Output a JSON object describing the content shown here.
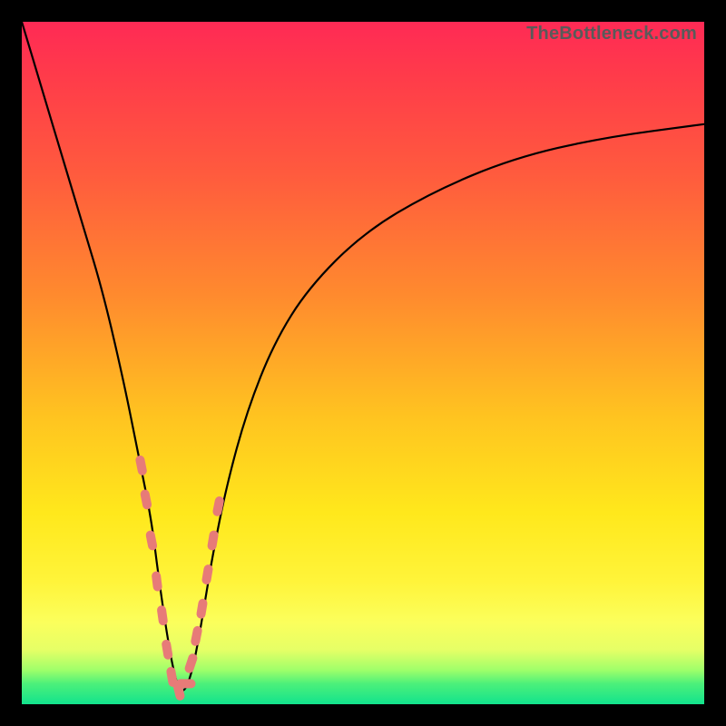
{
  "watermark": "TheBottleneck.com",
  "colors": {
    "background": "#000000",
    "gradient_top": "#ff2a55",
    "gradient_mid1": "#ff8a2e",
    "gradient_mid2": "#ffe81c",
    "gradient_bottom": "#12e38d",
    "curve": "#000000",
    "beads": "#e77b78"
  },
  "chart_data": {
    "type": "line",
    "title": "",
    "xlabel": "",
    "ylabel": "",
    "xlim": [
      0,
      100
    ],
    "ylim": [
      0,
      100
    ],
    "note": "Axes are normalized percentages; y=0 at bottom. Sharp V-shaped bottleneck curve with minimum near x≈23.",
    "series": [
      {
        "name": "bottleneck-curve",
        "x": [
          0,
          3,
          6,
          9,
          12,
          15,
          17,
          19,
          20,
          21,
          22,
          23,
          24,
          25,
          26,
          27,
          28,
          30,
          33,
          37,
          42,
          50,
          60,
          72,
          85,
          100
        ],
        "y": [
          100,
          90,
          80,
          70,
          60,
          47,
          37,
          27,
          19,
          12,
          6,
          2,
          2,
          5,
          10,
          16,
          22,
          32,
          43,
          53,
          61,
          69,
          75,
          80,
          83,
          85
        ]
      }
    ],
    "annotations": {
      "beads_note": "Salmon bead markers clustered along the two curve legs near the trough (approx y 5–25%).",
      "beads_xy": [
        [
          17.5,
          35
        ],
        [
          18.2,
          30
        ],
        [
          19.0,
          24
        ],
        [
          19.8,
          18
        ],
        [
          20.6,
          13
        ],
        [
          21.3,
          8
        ],
        [
          22.0,
          4
        ],
        [
          23.0,
          2
        ],
        [
          24.0,
          3
        ],
        [
          24.8,
          6
        ],
        [
          25.6,
          10
        ],
        [
          26.4,
          14
        ],
        [
          27.2,
          19
        ],
        [
          28.0,
          24
        ],
        [
          28.8,
          29
        ]
      ]
    }
  }
}
